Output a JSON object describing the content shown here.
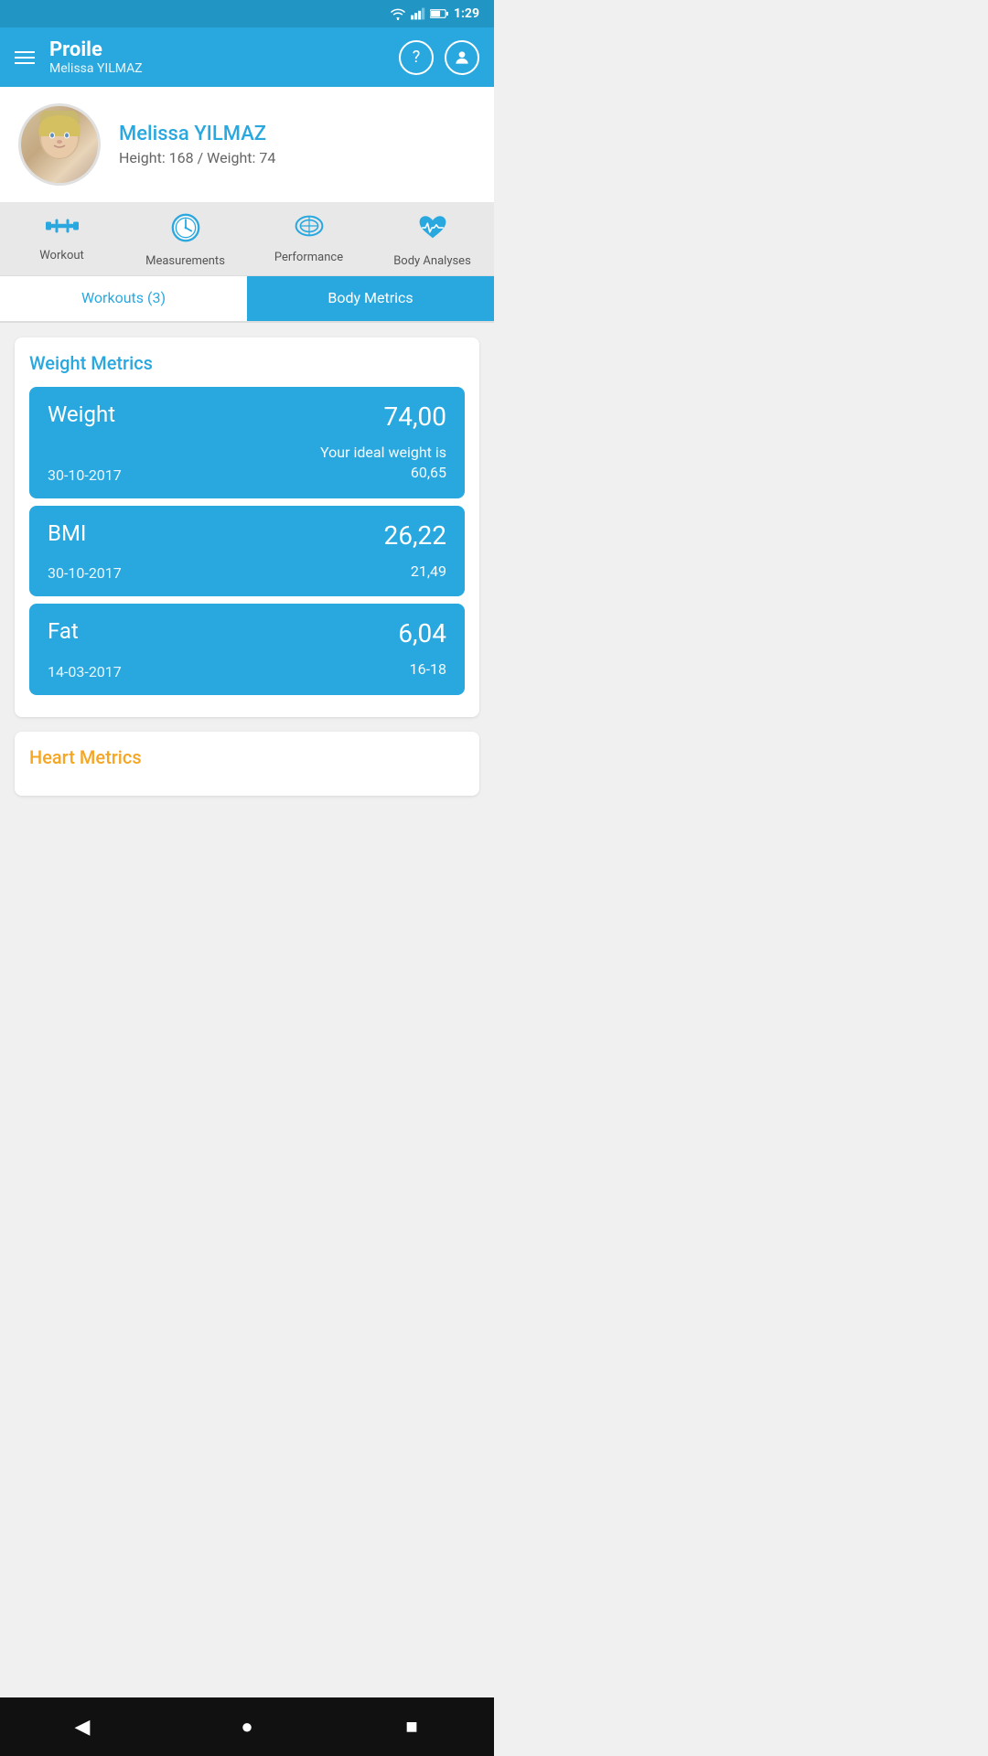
{
  "statusBar": {
    "time": "1:29",
    "icons": [
      "wifi",
      "signal",
      "battery"
    ]
  },
  "header": {
    "title": "Proile",
    "subtitle": "Melissa YILMAZ",
    "helpLabel": "?",
    "profileLabel": "profile"
  },
  "profile": {
    "name": "Melissa YILMAZ",
    "stats": "Height: 168 / Weight: 74"
  },
  "navTabs": [
    {
      "id": "workout",
      "label": "Workout"
    },
    {
      "id": "measurements",
      "label": "Measurements"
    },
    {
      "id": "performance",
      "label": "Performance"
    },
    {
      "id": "body-analyses",
      "label": "Body Analyses"
    }
  ],
  "subTabs": [
    {
      "id": "workouts",
      "label": "Workouts (3)",
      "active": false
    },
    {
      "id": "body-metrics",
      "label": "Body Metrics",
      "active": true
    }
  ],
  "weightMetrics": {
    "sectionTitle": "Weight Metrics",
    "cards": [
      {
        "name": "Weight",
        "value": "74,00",
        "date": "30-10-2017",
        "note": "Your ideal weight is\n60,65"
      },
      {
        "name": "BMI",
        "value": "26,22",
        "date": "30-10-2017",
        "note": "21,49"
      },
      {
        "name": "Fat",
        "value": "6,04",
        "date": "14-03-2017",
        "note": "16-18"
      }
    ]
  },
  "heartMetrics": {
    "sectionTitle": "Heart Metrics"
  },
  "navBar": {
    "back": "◀",
    "home": "●",
    "recent": "■"
  }
}
